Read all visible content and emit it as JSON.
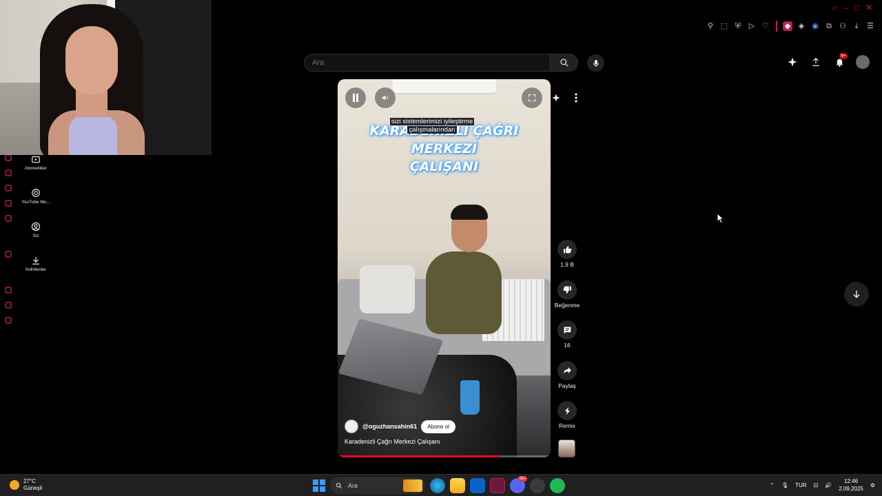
{
  "window_controls": [
    "search-icon",
    "minimize-icon",
    "maximize-icon",
    "close-icon"
  ],
  "toolbar_icons": [
    "pin-icon",
    "screenshot-icon",
    "shield-icon",
    "play-icon",
    "heart-icon",
    "extension-icon",
    "diamond-icon",
    "audio-icon",
    "puzzle-icon",
    "profile-icon",
    "download-icon",
    "menu-icon"
  ],
  "search": {
    "placeholder": "Ara"
  },
  "header": {
    "notification_count": "9+"
  },
  "guide": {
    "items": [
      {
        "label": "Abonelikler",
        "icon": "subscriptions-icon"
      },
      {
        "label": "YouTube Mu...",
        "icon": "youtube-music-icon"
      },
      {
        "label": "Siz",
        "icon": "you-icon"
      },
      {
        "label": "İndirilenler",
        "icon": "downloads-icon"
      }
    ]
  },
  "video": {
    "title_overlay_line1": "KARADENİZLİ ÇAĞRI MERKEZİ",
    "title_overlay_line2": "ÇALIŞANI",
    "caption_line1": "sizi sistemlerimizi iyileştirme",
    "caption_line2": "çalışmalarından",
    "channel_handle": "@oguzhansahin61",
    "subscribe_label": "Abone ol",
    "description": "Karadenizli Çağrı Merkezi Çalışanı",
    "progress": 0.76
  },
  "actions": {
    "like_count": "1,9 B",
    "dislike_label": "Beğenme",
    "comment_count": "16",
    "share_label": "Paylaş",
    "remix_label": "Remix"
  },
  "taskbar": {
    "temperature": "27°C",
    "weather": "Güneşli",
    "search_label": "Ara",
    "discord_badge": "99+",
    "language": "TUR",
    "time": "12:46",
    "date": "2.09.2025"
  },
  "colors": {
    "accent": "#c2185b",
    "youtube_red": "#ff0033",
    "background": "#000000"
  }
}
